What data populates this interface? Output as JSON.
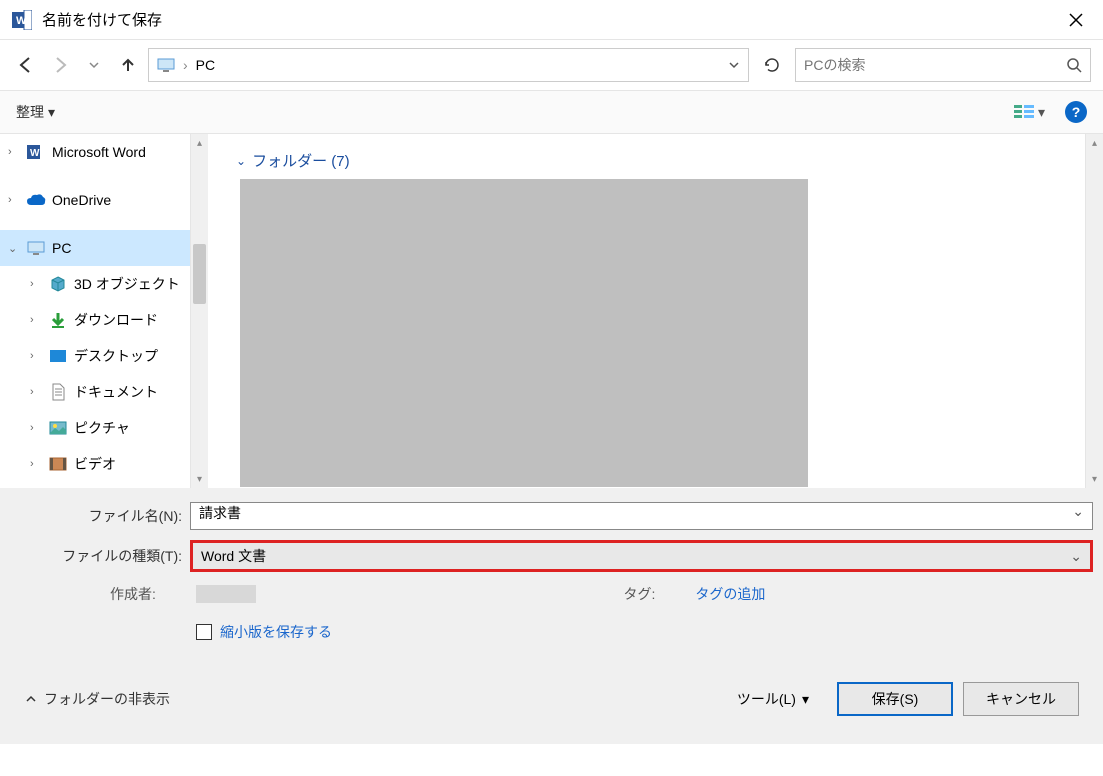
{
  "titlebar": {
    "title": "名前を付けて保存"
  },
  "address": {
    "crumb": "PC"
  },
  "search": {
    "placeholder": "PCの検索"
  },
  "toolbar": {
    "organize": "整理"
  },
  "tree": {
    "word": "Microsoft Word",
    "onedrive": "OneDrive",
    "pc": "PC",
    "objects3d": "3D オブジェクト",
    "downloads": "ダウンロード",
    "desktop": "デスクトップ",
    "documents": "ドキュメント",
    "pictures": "ピクチャ",
    "videos": "ビデオ"
  },
  "content": {
    "folders_header": "フォルダー (7)"
  },
  "fields": {
    "filename_label": "ファイル名(N):",
    "filename_value": "請求書",
    "filetype_label": "ファイルの種類(T):",
    "filetype_value": "Word 文書",
    "author_label": "作成者:",
    "tag_label": "タグ:",
    "tag_add": "タグの追加",
    "thumbnail": "縮小版を保存する"
  },
  "actions": {
    "hide_folders": "フォルダーの非表示",
    "tools": "ツール(L)",
    "save": "保存(S)",
    "cancel": "キャンセル"
  }
}
